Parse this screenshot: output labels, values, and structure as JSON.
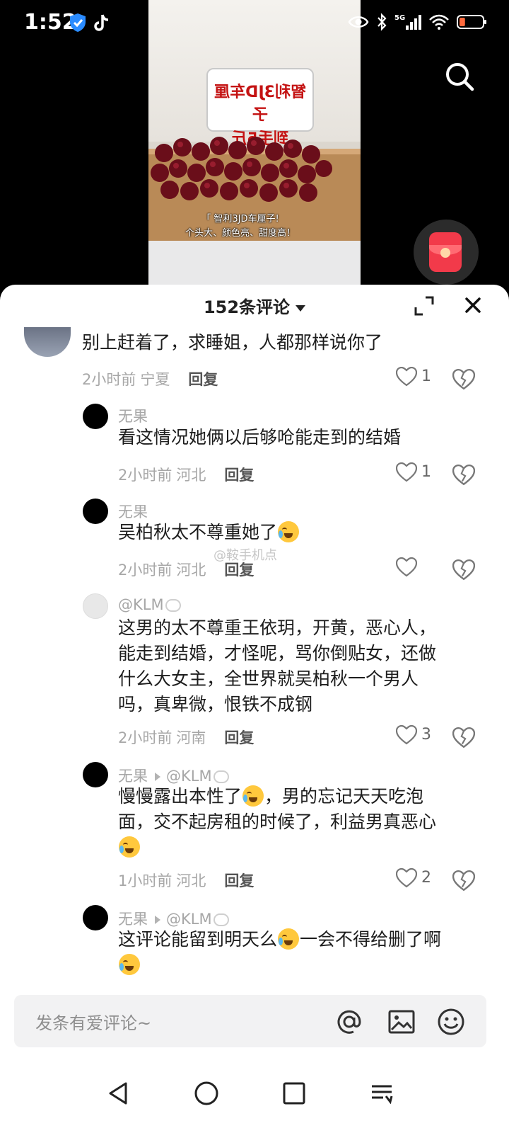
{
  "status_bar": {
    "time": "1:52",
    "network": "5G",
    "battery_level": 0.25,
    "battery_color": "#ff6a3d"
  },
  "video": {
    "sign_line1": "智利3JD车厘子",
    "sign_line2": "到手5斤",
    "caption_line1": "「 智利3JD车厘子!",
    "caption_line2": "个头大、颜色亮、甜度高！"
  },
  "header": {
    "title": "152条评论"
  },
  "comments": [
    {
      "text": "别上赶着了，求睡姐，人都那样说你了",
      "time": "2小时前",
      "region": "宁夏",
      "reply": "回复",
      "likes": "1"
    },
    {
      "name": "无果",
      "text": "看这情况她俩以后够呛能走到的结婚",
      "time": "2小时前",
      "region": "河北",
      "reply": "回复",
      "likes": "1"
    },
    {
      "name": "无果",
      "text": "吴柏秋太不尊重她了",
      "time": "2小时前",
      "region": "河北",
      "reply": "回复",
      "likes": ""
    },
    {
      "name": "@KLM",
      "text_lines": [
        "这男的太不尊重王依玥，开黄，恶心人，",
        "能走到结婚，才怪呢，骂你倒贴女，还做",
        "什么大女主，全世界就吴柏秋一个男人",
        "吗，真卑微，恨铁不成钢"
      ],
      "time": "2小时前",
      "region": "河南",
      "reply": "回复",
      "likes": "3"
    },
    {
      "name": "无果",
      "reply_to": "@KLM",
      "text_part1": "慢慢露出本性了",
      "text_part2": "，男的忘记天天吃泡",
      "text_line2": "面，交不起房租的时候了，利益男真恶心",
      "time": "1小时前",
      "region": "河北",
      "reply": "回复",
      "likes": "2"
    },
    {
      "name": "无果",
      "reply_to": "@KLM",
      "text_part1": "这评论能留到明天么",
      "text_part2": "一会不得给删了啊"
    }
  ],
  "watermark": "@鞍手机点",
  "input": {
    "placeholder": "发条有爱评论~"
  }
}
